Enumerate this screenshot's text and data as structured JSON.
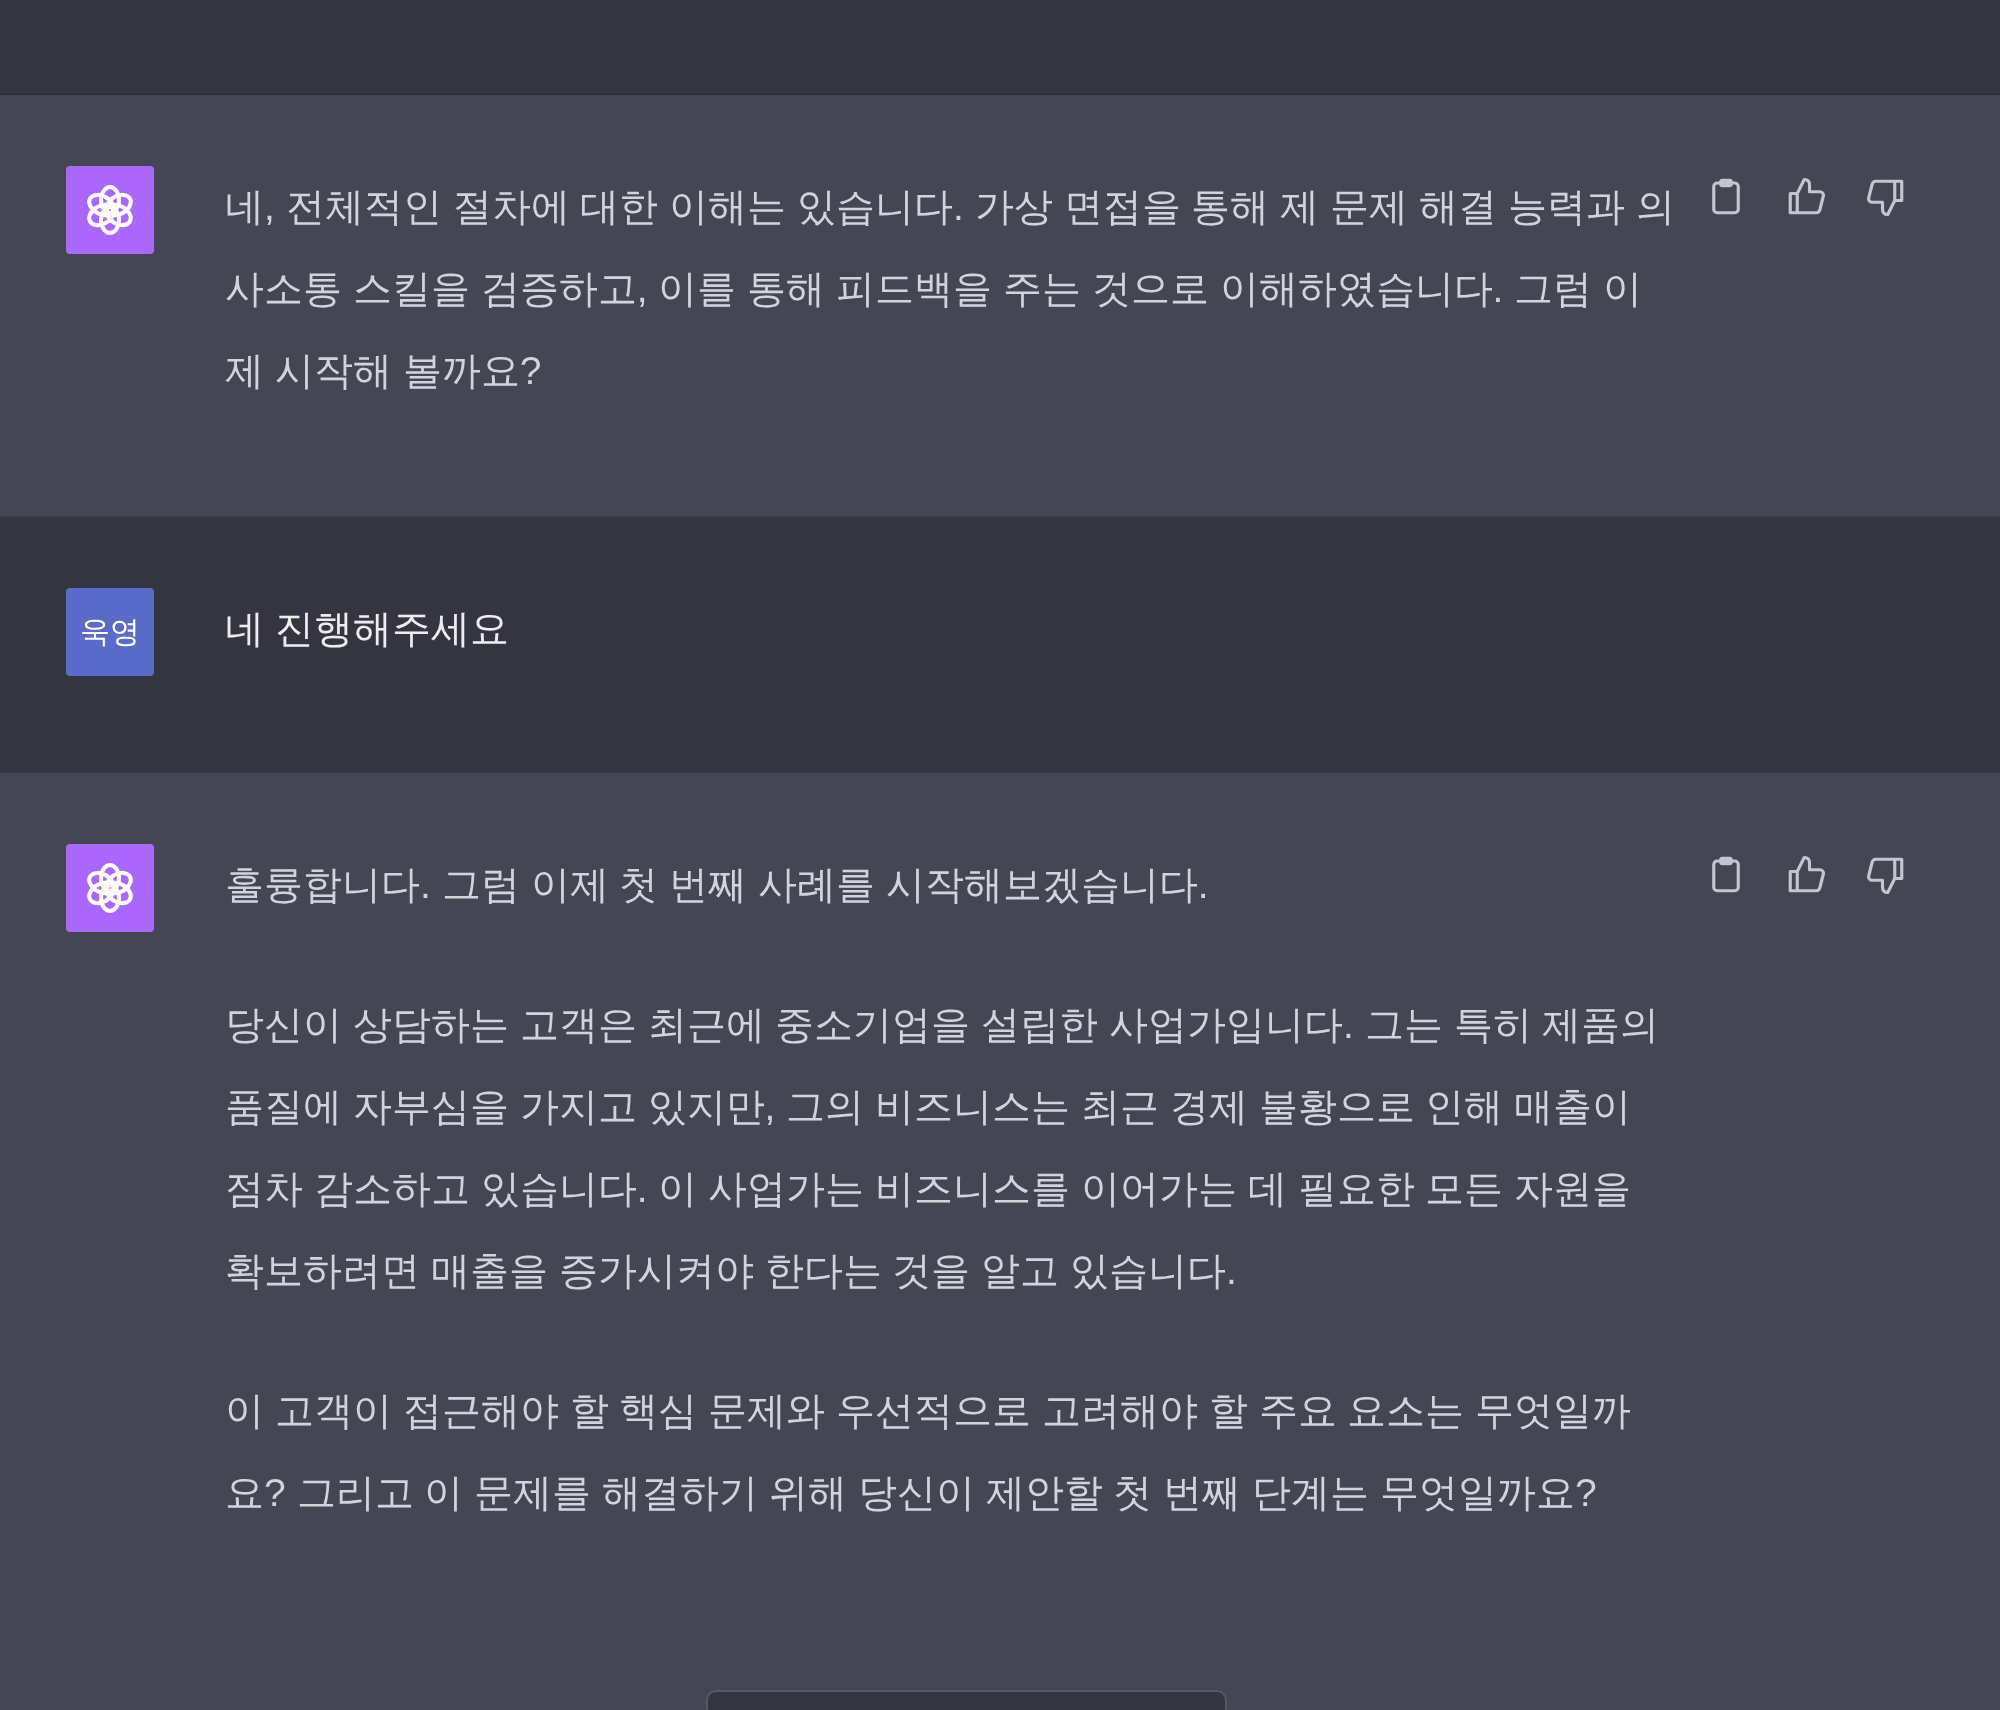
{
  "messages": [
    {
      "kind": "assistant",
      "paragraphs": [
        "네, 전체적인 절차에 대한 이해는 있습니다. 가상 면접을 통해 제 문제 해결 능력과 의사소통 스킬을 검증하고, 이를 통해 피드백을 주는 것으로 이해하였습니다. 그럼 이제 시작해 볼까요?"
      ]
    },
    {
      "kind": "user",
      "avatar": "욱영",
      "paragraphs": [
        "네 진행해주세요"
      ]
    },
    {
      "kind": "assistant",
      "paragraphs": [
        "훌륭합니다. 그럼 이제 첫 번째 사례를 시작해보겠습니다.",
        "당신이 상담하는 고객은 최근에 중소기업을 설립한 사업가입니다. 그는 특히 제품의 품질에 자부심을 가지고 있지만, 그의 비즈니스는 최근 경제 불황으로 인해 매출이 점차 감소하고 있습니다. 이 사업가는 비즈니스를 이어가는 데 필요한 모든 자원을 확보하려면 매출을 증가시켜야 한다는 것을 알고 있습니다.",
        "이 고객이 접근해야 할 핵심 문제와 우선적으로 고려해야 할 주요 요소는 무엇일까요? 그리고 이 문제를 해결하기 위해 당신이 제안할 첫 번째 단계는 무엇일까요?"
      ]
    }
  ]
}
